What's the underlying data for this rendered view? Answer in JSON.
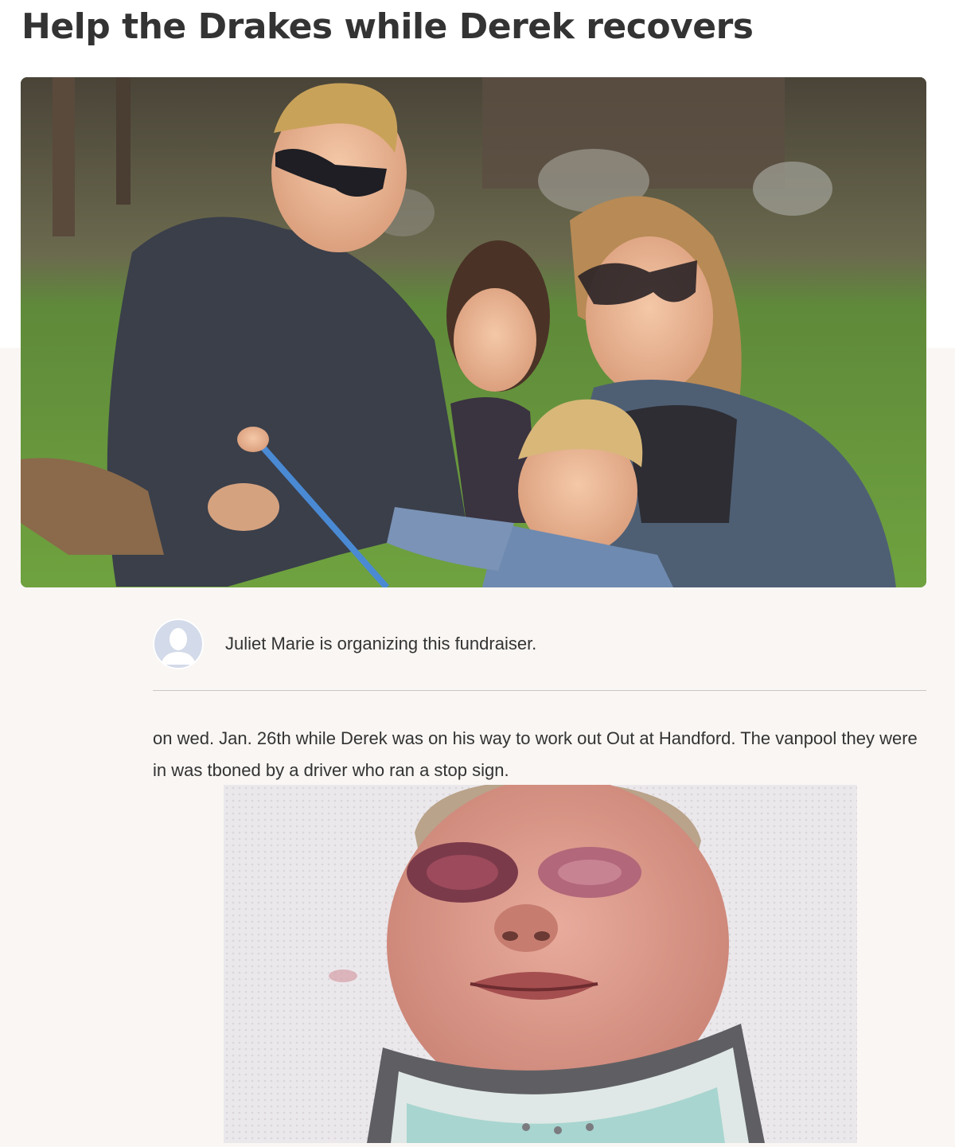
{
  "campaign": {
    "title": "Help the Drakes while Derek recovers"
  },
  "hero_image": {
    "description": "Family photo of two adults and two children kneeling on a grassy lawn"
  },
  "organizer": {
    "text": "Juliet Marie is organizing this fundraiser."
  },
  "story": {
    "paragraph": "on wed. Jan. 26th while Derek was on his way to work out Out at Handford. The vanpool they were in was tboned by a driver who ran a stop sign."
  },
  "story_image": {
    "description": "Close-up of an injured man lying on a hospital bed wearing a neck brace"
  }
}
